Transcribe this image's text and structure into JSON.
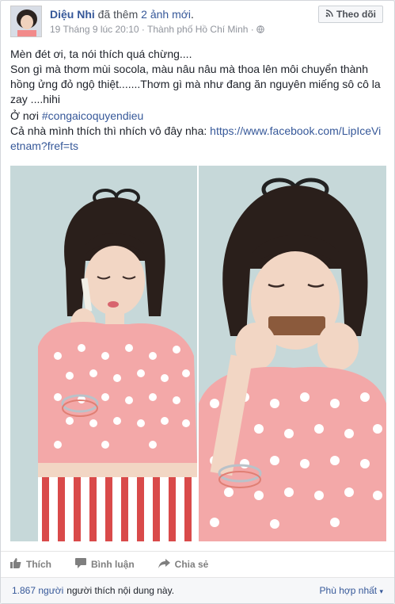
{
  "author": {
    "name": "Diệu Nhi",
    "action_prefix": "đã thêm",
    "action_link": "2 ảnh mới",
    "action_suffix": "."
  },
  "meta": {
    "timestamp": "19 Tháng 9 lúc 20:10",
    "separator": "·",
    "location": "Thành phố Hồ Chí Minh",
    "separator2": "·"
  },
  "follow_button": {
    "label": "Theo dõi"
  },
  "post": {
    "line1": "Mèn đét ơi, ta nói thích quá chừng....",
    "line2": "Son gì mà thơm mùi socola, màu nâu nâu mà thoa lên môi chuyển thành hồng ửng đỏ ngộ thiệt.......Thơm gì mà như đang ăn nguyên miếng sô cô la zay ....hihi",
    "line3_prefix": "Ở nơi",
    "hashtag": "#congaicoquyendieu",
    "line4_prefix": "Cả nhà mình thích thì nhích vô đây nha:",
    "url": "https://www.facebook.com/LipIceVietnam?fref=ts"
  },
  "actions": {
    "like": "Thích",
    "comment": "Bình luận",
    "share": "Chia sẻ"
  },
  "likes": {
    "count": "1.867 người",
    "rest": "người thích nội dung này.",
    "sort": "Phù hợp nhất"
  },
  "colors": {
    "link": "#365899",
    "muted": "#90949c",
    "photo_bg": "#c8d9da",
    "top_pink": "#f3a8a8",
    "stripe_red": "#d94a4a"
  }
}
